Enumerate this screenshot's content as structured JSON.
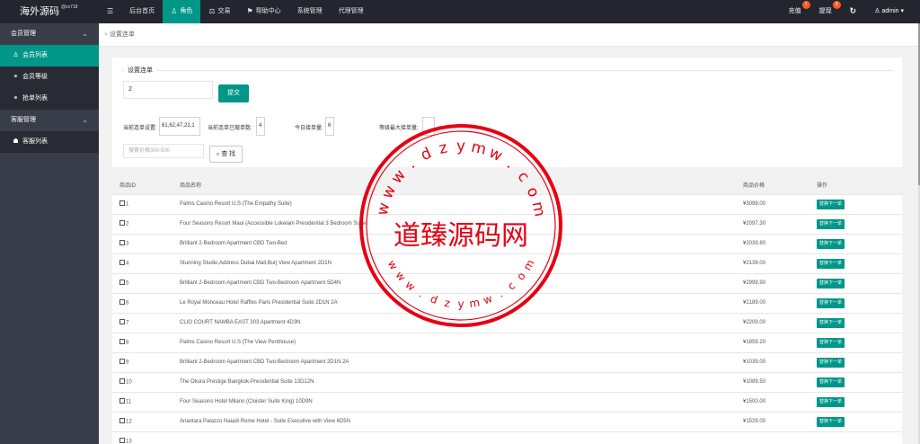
{
  "header": {
    "logo": "海外源码",
    "logo_sup": "@zx718",
    "menu_toggle_icon": "☰",
    "nav": [
      {
        "label": "后台首页",
        "icon": "",
        "active": false
      },
      {
        "label": "角色",
        "icon": "♙",
        "active": true
      },
      {
        "label": "交易",
        "icon": "⚖",
        "active": false
      },
      {
        "label": "帮助中心",
        "icon": "⚑",
        "active": false
      },
      {
        "label": "系统管理",
        "icon": "",
        "active": false
      },
      {
        "label": "代理管理",
        "icon": "",
        "active": false
      }
    ],
    "right": {
      "recharge_label": "充值",
      "recharge_badge": "1",
      "withdraw_label": "提现",
      "withdraw_badge": "0",
      "refresh_icon": "↻",
      "user_label": "admin",
      "user_icon": "♙",
      "dropdown_icon": "▾"
    }
  },
  "sidebar": {
    "groups": [
      {
        "label": "会员管理",
        "items": [
          {
            "label": "会员列表",
            "icon": "♙",
            "active": true
          },
          {
            "label": "会员等级",
            "icon": "🔗",
            "active": false
          },
          {
            "label": "抢单列表",
            "icon": "🔗",
            "active": false
          }
        ]
      },
      {
        "label": "客服管理",
        "items": [
          {
            "label": "客服列表",
            "icon": "👥",
            "active": false
          }
        ]
      }
    ]
  },
  "breadcrumb": {
    "sep": "»",
    "label": "设置连单"
  },
  "form": {
    "legend": "设置连单",
    "count_value": "2",
    "submit_label": "提交",
    "current_setting_label": "当前连单设置:",
    "current_setting_value": "61,62,47,21,1",
    "done_label": "当前连单已做单数:",
    "done_value": "4",
    "today_label": "今日接单量:",
    "today_value": "6",
    "max_label": "等级最大接单量:",
    "max_value": "",
    "search_placeholder": "搜索价格300-500",
    "search_label": "查 找",
    "search_icon": "🔍"
  },
  "table": {
    "headers": [
      "商品ID",
      "商品名称",
      "商品价格",
      "操作"
    ],
    "action_label": "替换下一单",
    "rows": [
      {
        "id": "1",
        "name": "Palms Casino Resort U.S (The Empathy Suite)",
        "price": "¥3098.00"
      },
      {
        "id": "2",
        "name": "Four Seasons Resort Maui (Accessible Lokelani Presidential 3 Bedroom Suite)",
        "price": "¥2097.30"
      },
      {
        "id": "3",
        "name": "Brilliant 2-Bedroom Apartment CBD Two-Bed",
        "price": "¥2039.80"
      },
      {
        "id": "4",
        "name": "Stunning Studio,Address Dubai Mall,Burj View Apartment 2D1N",
        "price": "¥2139.00"
      },
      {
        "id": "5",
        "name": "Brilliant 2-Bedroom Apartment CBD Two-Bedroom Apartment 5D4N",
        "price": "¥2999.90"
      },
      {
        "id": "6",
        "name": "Le Royal Monceau Hotel Raffles Paris Presidential Suite 2D1N 2A",
        "price": "¥2189.00"
      },
      {
        "id": "7",
        "name": "CLIO COURT NAMBA EAST 303 Apartment 4D3N",
        "price": "¥2209.00"
      },
      {
        "id": "8",
        "name": "Palms Casino Resort U.S (The View Penthouse)",
        "price": "¥1859.20"
      },
      {
        "id": "9",
        "name": "Brilliant 2-Bedroom Apartment CBD Two-Bedroom Apartment 2D1N 2A",
        "price": "¥1039.00"
      },
      {
        "id": "10",
        "name": "The Okura Prestige Bangkok-Presidential Suite 13D12N",
        "price": "¥1089.50"
      },
      {
        "id": "11",
        "name": "Four Seasons Hotel Milano (Cloister Suite King) 10D9N",
        "price": "¥1500.00"
      },
      {
        "id": "12",
        "name": "Anantara Palazzo Naiadi Rome Hotel - Suite Executive with View 6D5N",
        "price": "¥1529.00"
      },
      {
        "id": "13",
        "name": "",
        "price": ""
      }
    ]
  },
  "watermark": {
    "center_text": "道臻源码网",
    "ring_text": "www.dzymw.com",
    "color": "#e60012"
  },
  "colors": {
    "accent": "#009688",
    "topbar": "#23262e",
    "sidebar": "#393d49",
    "badge": "#ff5722"
  }
}
